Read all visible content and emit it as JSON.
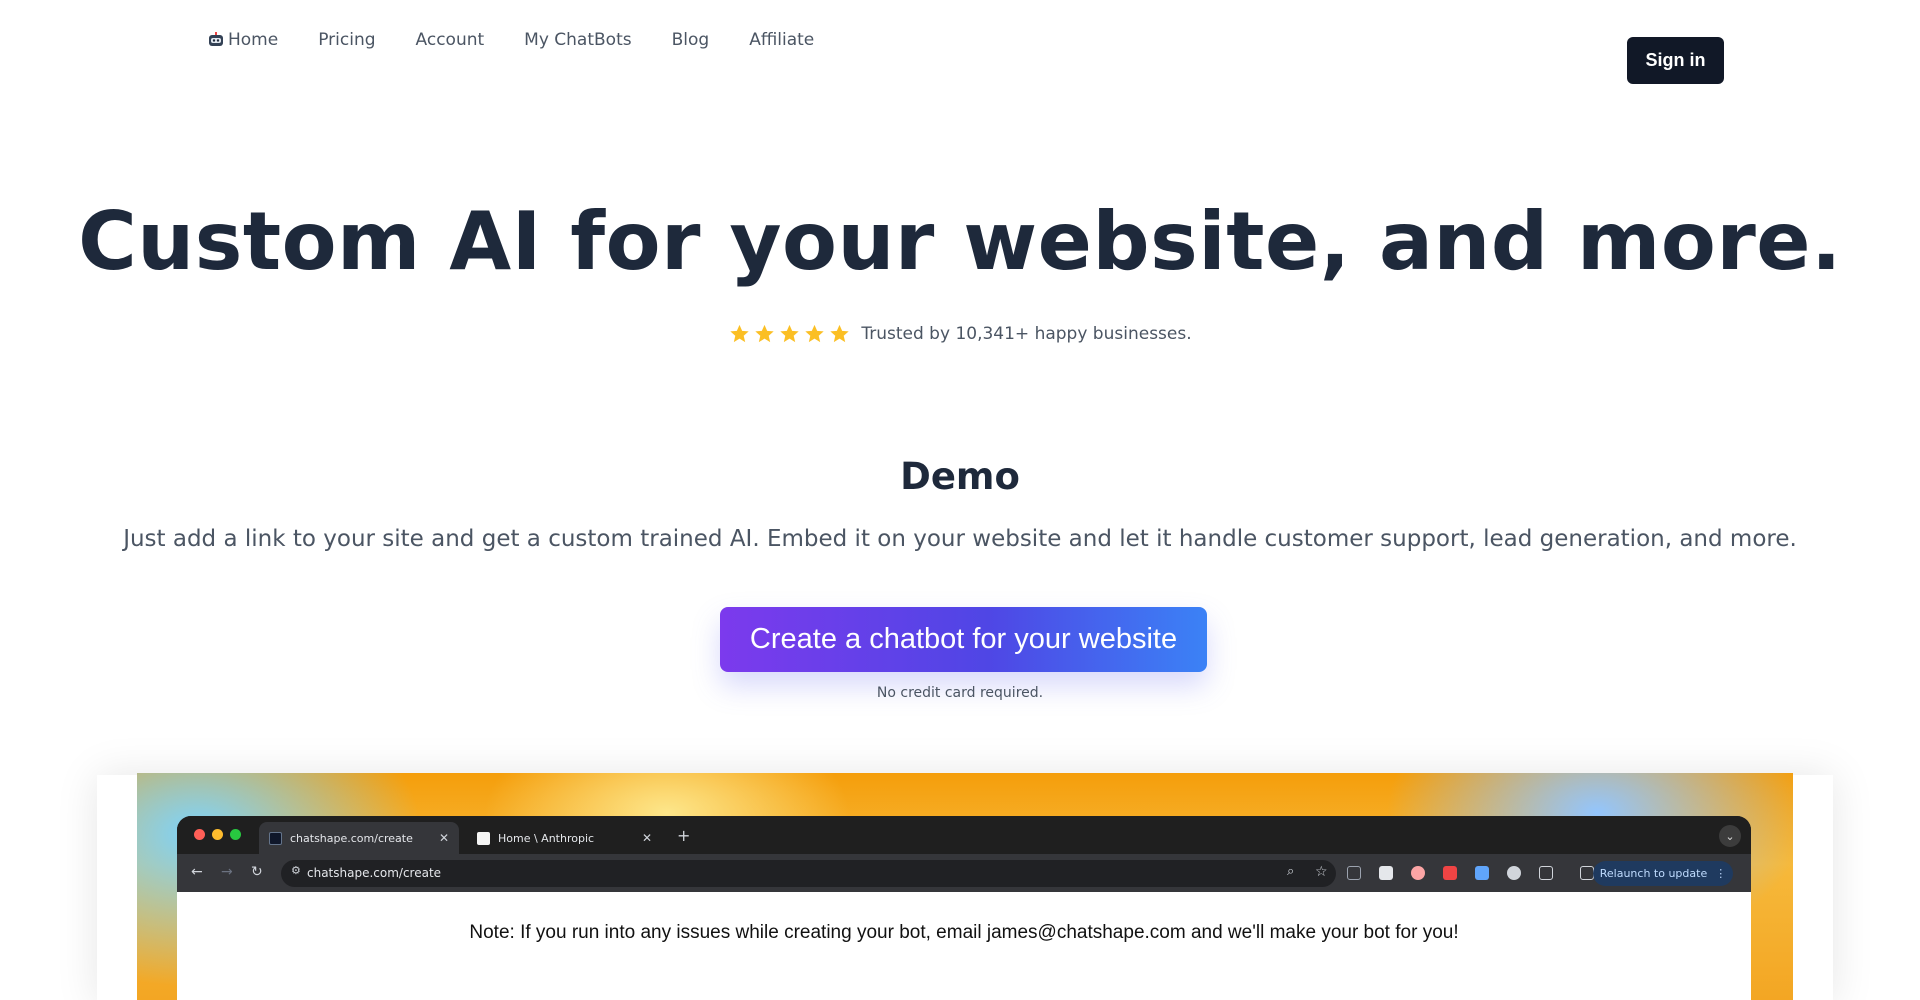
{
  "nav": {
    "items": [
      {
        "label": "Home",
        "icon": "robot-icon"
      },
      {
        "label": "Pricing"
      },
      {
        "label": "Account"
      },
      {
        "label": "My ChatBots"
      },
      {
        "label": "Blog"
      },
      {
        "label": "Affiliate"
      }
    ],
    "signin_label": "Sign in"
  },
  "hero": {
    "title": "Custom AI for your website, and more.",
    "rating_stars": 5,
    "trust_text": "Trusted by 10,341+ happy businesses."
  },
  "demo": {
    "title": "Demo",
    "description": "Just add a link to your site and get a custom trained AI. Embed it on your website and let it handle customer support, lead generation, and more.",
    "cta_label": "Create a chatbot for your website",
    "cta_note": "No credit card required."
  },
  "video": {
    "tabs": [
      {
        "label": "chatshape.com/create",
        "icon": "robot-icon"
      },
      {
        "label": "Home \\ Anthropic",
        "icon": "anthropic-icon"
      }
    ],
    "url": "chatshape.com/create",
    "relaunch_label": "Relaunch to update",
    "page_note": "Note: If you run into any issues while creating your bot, email james@chatshape.com and we'll make your bot for you!"
  },
  "colors": {
    "accent_start": "#7c3aed",
    "accent_end": "#3b82f6",
    "signin_bg": "#111827",
    "star": "#fbbf24",
    "heading": "#1e293b"
  }
}
